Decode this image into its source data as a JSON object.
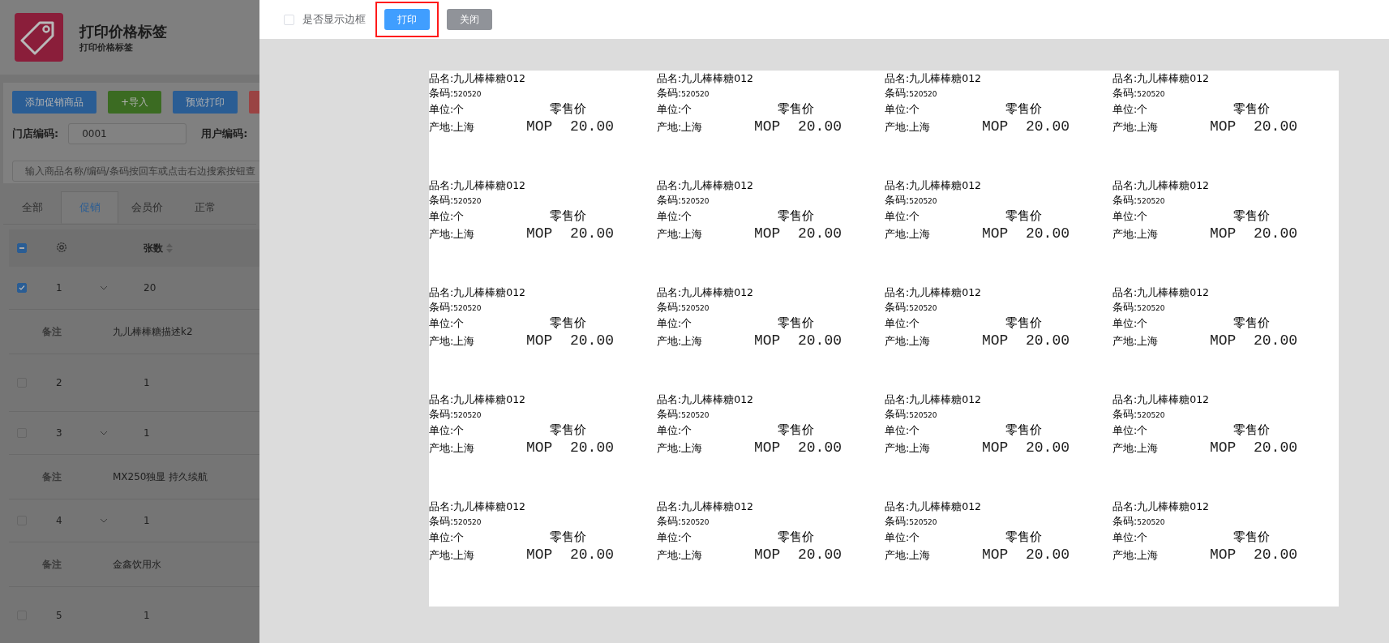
{
  "page": {
    "title": "打印价格标签",
    "subtitle": "打印价格标签",
    "toolbar": [
      {
        "label": "添加促销商品",
        "kind": "primary"
      },
      {
        "label": "+导入",
        "kind": "success"
      },
      {
        "label": "预览打印",
        "kind": "primary"
      },
      {
        "kind": "danger"
      }
    ],
    "store_code": {
      "label": "门店编码:",
      "value": "0001"
    },
    "user_code": {
      "label": "用户编码:"
    },
    "search": {
      "placeholder": "输入商品名称/编码/条码按回车或点击右边搜索按钮查"
    },
    "tabs": [
      {
        "label": "全部",
        "selected": false
      },
      {
        "label": "促销",
        "selected": true
      },
      {
        "label": "会员价",
        "selected": false
      },
      {
        "label": "正常",
        "selected": false
      }
    ],
    "table": {
      "select_all": {
        "indeterminate": true
      },
      "columns": [
        "张数"
      ],
      "rows": [
        {
          "kind": "item",
          "index": "1",
          "checked": true,
          "expandable": true,
          "count": "20"
        },
        {
          "kind": "remark",
          "label": "备注",
          "text": "九儿棒棒糖描述k2"
        },
        {
          "kind": "item",
          "index": "2",
          "checked": false,
          "expandable": false,
          "count": "1"
        },
        {
          "kind": "item",
          "index": "3",
          "checked": false,
          "expandable": true,
          "count": "1"
        },
        {
          "kind": "remark",
          "label": "备注",
          "text": "MX250独显 持久续航"
        },
        {
          "kind": "item",
          "index": "4",
          "checked": false,
          "expandable": true,
          "count": "1"
        },
        {
          "kind": "remark",
          "label": "备注",
          "text": "金鑫饮用水"
        },
        {
          "kind": "item",
          "index": "5",
          "checked": false,
          "expandable": false,
          "count": "1"
        }
      ]
    }
  },
  "drawer": {
    "show_border": {
      "label": "是否显示边框",
      "checked": false
    },
    "print_button": {
      "label": "打印",
      "highlighted": true
    },
    "close_button": {
      "label": "关闭"
    },
    "labels": [
      {
        "name": "品名:九儿棒棒糖012",
        "barcode_label": "条码:",
        "barcode": "520520",
        "unit": "单位:个",
        "price_title": "零售价",
        "origin": "产地:上海",
        "price": "MOP  20.00"
      },
      {
        "name": "品名:九儿棒棒糖012",
        "barcode_label": "条码:",
        "barcode": "520520",
        "unit": "单位:个",
        "price_title": "零售价",
        "origin": "产地:上海",
        "price": "MOP  20.00"
      },
      {
        "name": "品名:九儿棒棒糖012",
        "barcode_label": "条码:",
        "barcode": "520520",
        "unit": "单位:个",
        "price_title": "零售价",
        "origin": "产地:上海",
        "price": "MOP  20.00"
      },
      {
        "name": "品名:九儿棒棒糖012",
        "barcode_label": "条码:",
        "barcode": "520520",
        "unit": "单位:个",
        "price_title": "零售价",
        "origin": "产地:上海",
        "price": "MOP  20.00"
      },
      {
        "name": "品名:九儿棒棒糖012",
        "barcode_label": "条码:",
        "barcode": "520520",
        "unit": "单位:个",
        "price_title": "零售价",
        "origin": "产地:上海",
        "price": "MOP  20.00"
      },
      {
        "name": "品名:九儿棒棒糖012",
        "barcode_label": "条码:",
        "barcode": "520520",
        "unit": "单位:个",
        "price_title": "零售价",
        "origin": "产地:上海",
        "price": "MOP  20.00"
      },
      {
        "name": "品名:九儿棒棒糖012",
        "barcode_label": "条码:",
        "barcode": "520520",
        "unit": "单位:个",
        "price_title": "零售价",
        "origin": "产地:上海",
        "price": "MOP  20.00"
      },
      {
        "name": "品名:九儿棒棒糖012",
        "barcode_label": "条码:",
        "barcode": "520520",
        "unit": "单位:个",
        "price_title": "零售价",
        "origin": "产地:上海",
        "price": "MOP  20.00"
      },
      {
        "name": "品名:九儿棒棒糖012",
        "barcode_label": "条码:",
        "barcode": "520520",
        "unit": "单位:个",
        "price_title": "零售价",
        "origin": "产地:上海",
        "price": "MOP  20.00"
      },
      {
        "name": "品名:九儿棒棒糖012",
        "barcode_label": "条码:",
        "barcode": "520520",
        "unit": "单位:个",
        "price_title": "零售价",
        "origin": "产地:上海",
        "price": "MOP  20.00"
      },
      {
        "name": "品名:九儿棒棒糖012",
        "barcode_label": "条码:",
        "barcode": "520520",
        "unit": "单位:个",
        "price_title": "零售价",
        "origin": "产地:上海",
        "price": "MOP  20.00"
      },
      {
        "name": "品名:九儿棒棒糖012",
        "barcode_label": "条码:",
        "barcode": "520520",
        "unit": "单位:个",
        "price_title": "零售价",
        "origin": "产地:上海",
        "price": "MOP  20.00"
      },
      {
        "name": "品名:九儿棒棒糖012",
        "barcode_label": "条码:",
        "barcode": "520520",
        "unit": "单位:个",
        "price_title": "零售价",
        "origin": "产地:上海",
        "price": "MOP  20.00"
      },
      {
        "name": "品名:九儿棒棒糖012",
        "barcode_label": "条码:",
        "barcode": "520520",
        "unit": "单位:个",
        "price_title": "零售价",
        "origin": "产地:上海",
        "price": "MOP  20.00"
      },
      {
        "name": "品名:九儿棒棒糖012",
        "barcode_label": "条码:",
        "barcode": "520520",
        "unit": "单位:个",
        "price_title": "零售价",
        "origin": "产地:上海",
        "price": "MOP  20.00"
      },
      {
        "name": "品名:九儿棒棒糖012",
        "barcode_label": "条码:",
        "barcode": "520520",
        "unit": "单位:个",
        "price_title": "零售价",
        "origin": "产地:上海",
        "price": "MOP  20.00"
      },
      {
        "name": "品名:九儿棒棒糖012",
        "barcode_label": "条码:",
        "barcode": "520520",
        "unit": "单位:个",
        "price_title": "零售价",
        "origin": "产地:上海",
        "price": "MOP  20.00"
      },
      {
        "name": "品名:九儿棒棒糖012",
        "barcode_label": "条码:",
        "barcode": "520520",
        "unit": "单位:个",
        "price_title": "零售价",
        "origin": "产地:上海",
        "price": "MOP  20.00"
      },
      {
        "name": "品名:九儿棒棒糖012",
        "barcode_label": "条码:",
        "barcode": "520520",
        "unit": "单位:个",
        "price_title": "零售价",
        "origin": "产地:上海",
        "price": "MOP  20.00"
      },
      {
        "name": "品名:九儿棒棒糖012",
        "barcode_label": "条码:",
        "barcode": "520520",
        "unit": "单位:个",
        "price_title": "零售价",
        "origin": "产地:上海",
        "price": "MOP  20.00"
      }
    ]
  }
}
